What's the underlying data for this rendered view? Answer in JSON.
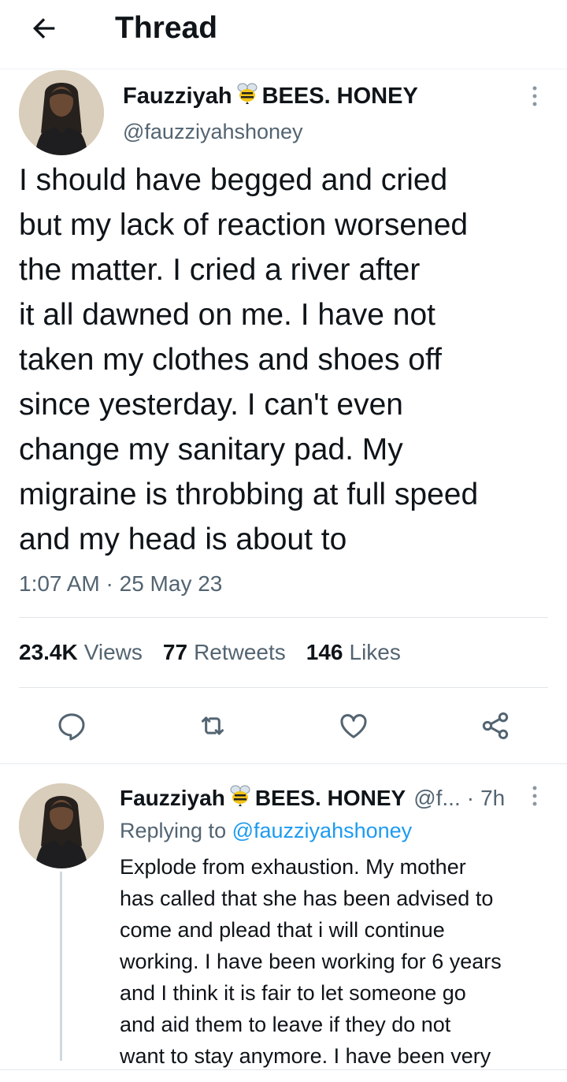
{
  "header": {
    "title": "Thread"
  },
  "tweet": {
    "display_name": "Fauzziyah",
    "name_suffix": "BEES. HONEY",
    "handle": "@fauzziyahshoney",
    "text": "I should have begged and cried\nbut my lack of reaction worsened\nthe matter. I cried a river after\nit all dawned on me. I have not\ntaken my clothes and shoes off\nsince yesterday. I can't even\nchange my sanitary pad. My\nmigraine is throbbing at full speed\nand my head is about to",
    "time": "1:07 AM",
    "separator": "·",
    "date": "25 May 23",
    "views_count": "23.4K",
    "views_label": "Views",
    "retweets_count": "77",
    "retweets_label": "Retweets",
    "likes_count": "146",
    "likes_label": "Likes"
  },
  "reply": {
    "display_name": "Fauzziyah",
    "name_suffix": "BEES. HONEY",
    "handle_truncated": "@f...",
    "dot": "·",
    "time_ago": "7h",
    "replying_label": "Replying to",
    "replying_handle": "@fauzziyahshoney",
    "text": "Explode from exhaustion. My mother\nhas called that she has been advised to\ncome and plead that i will continue\nworking. I have been working for 6 years\nand I think it is fair to let someone go\nand aid them to leave if they do not\nwant to stay anymore. I have been very"
  },
  "icons": [
    "arrow-left-icon",
    "more-vertical-icon",
    "reply-icon",
    "retweet-icon",
    "like-icon",
    "share-icon",
    "bee-icon"
  ],
  "colors": {
    "text": "#0f1419",
    "secondary": "#536471",
    "link": "#1d9bf0",
    "divider": "#eff3f4"
  }
}
